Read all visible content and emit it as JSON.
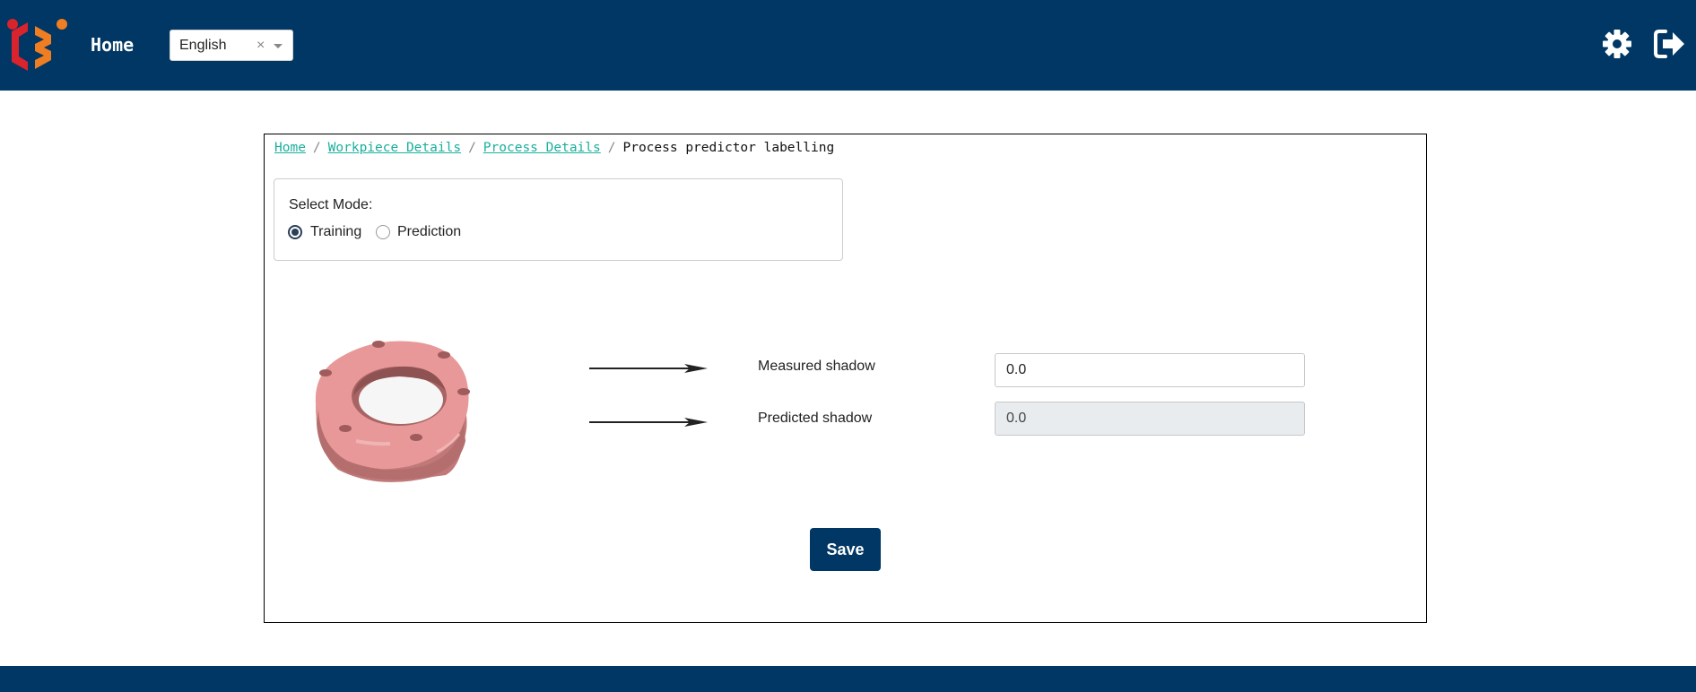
{
  "header": {
    "title": "Home",
    "language": {
      "selected": "English",
      "clear_glyph": "×"
    },
    "icons": {
      "logo": "logo-icon",
      "settings": "gear-icon",
      "logout": "logout-icon"
    },
    "colors": {
      "brand": "#003764",
      "accent_red": "#d9232d",
      "accent_orange": "#ef7d22"
    }
  },
  "breadcrumb": {
    "items": [
      "Home",
      "Workpiece Details",
      "Process Details"
    ],
    "separator": "/",
    "current": "Process predictor labelling",
    "link_color": "#1aaf9c"
  },
  "mode": {
    "label": "Select Mode:",
    "options": [
      {
        "label": "Training",
        "checked": true
      },
      {
        "label": "Prediction",
        "checked": false
      }
    ]
  },
  "fields": {
    "measured": {
      "label": "Measured shadow",
      "value": "0.0"
    },
    "predicted": {
      "label": "Predicted shadow",
      "value": "0.0"
    }
  },
  "workpiece": {
    "icon": "workpiece-image",
    "color": "#e89a9a"
  },
  "actions": {
    "save_label": "Save"
  }
}
